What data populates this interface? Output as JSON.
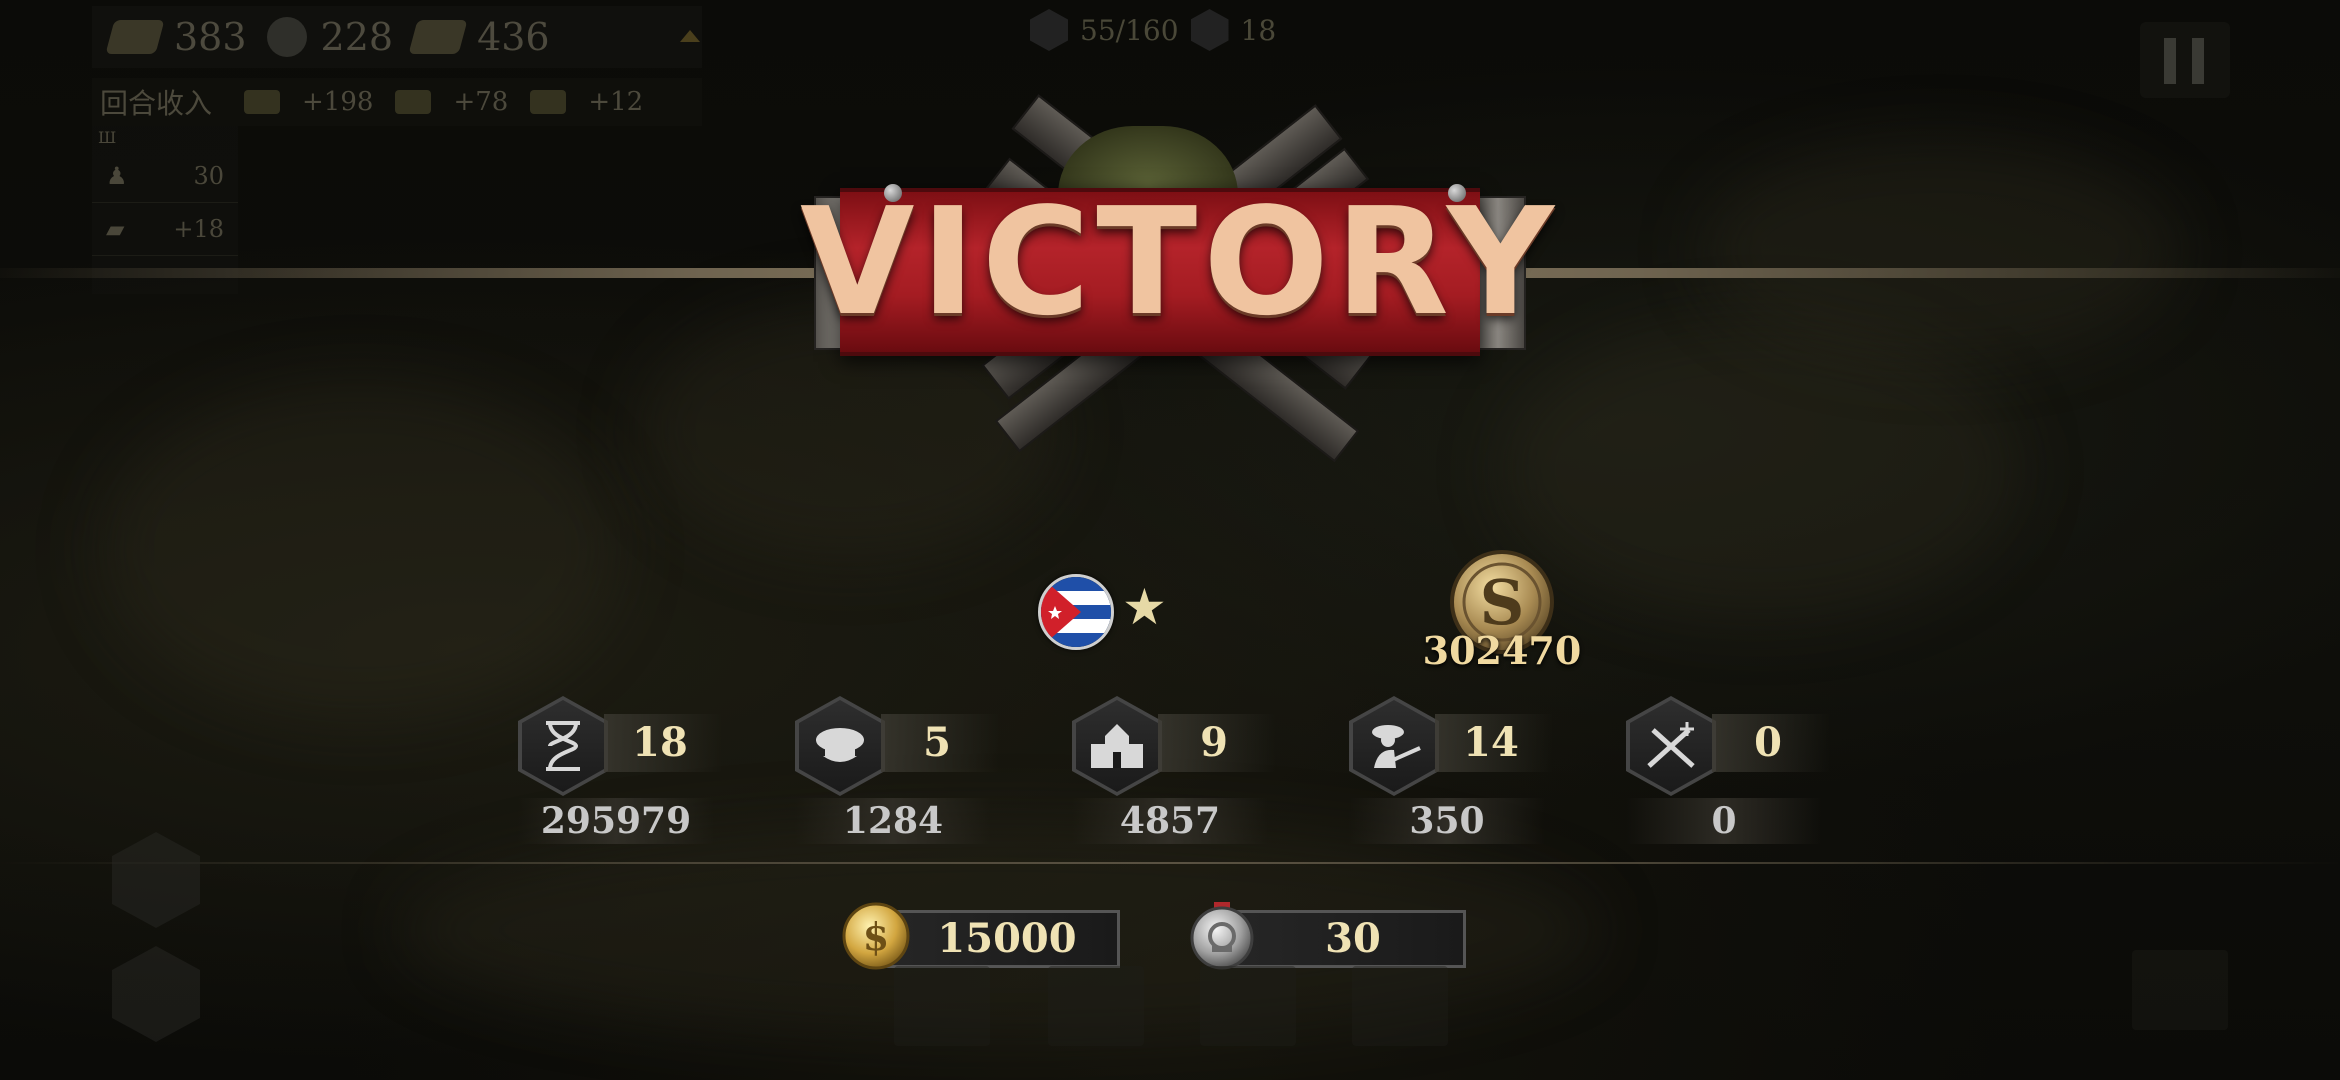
{
  "top_bar": {
    "gold": "383",
    "industry": "228",
    "oil": "436"
  },
  "income": {
    "label": "回合收入",
    "gold": "+198",
    "industry": "+78",
    "oil": "+12"
  },
  "side_panel": {
    "manpower": "30",
    "bonus": "+18"
  },
  "population": {
    "units": "55/160",
    "other": "18"
  },
  "result": {
    "title": "VICTORY",
    "score": "302470"
  },
  "stats": [
    {
      "icon": "hourglass-icon",
      "count": "18",
      "total": "295979"
    },
    {
      "icon": "officer-cap-icon",
      "count": "5",
      "total": "1284"
    },
    {
      "icon": "city-icon",
      "count": "9",
      "total": "4857"
    },
    {
      "icon": "soldier-icon",
      "count": "14",
      "total": "350"
    },
    {
      "icon": "crossed-swords-icon",
      "count": "0",
      "total": "0"
    }
  ],
  "rewards": {
    "coins": "15000",
    "medals": "30"
  },
  "colors": {
    "banner_red": "#b4232a",
    "title_text": "#f0c4a0",
    "value_text": "#efe2b4",
    "total_text": "#c8c8c8"
  }
}
